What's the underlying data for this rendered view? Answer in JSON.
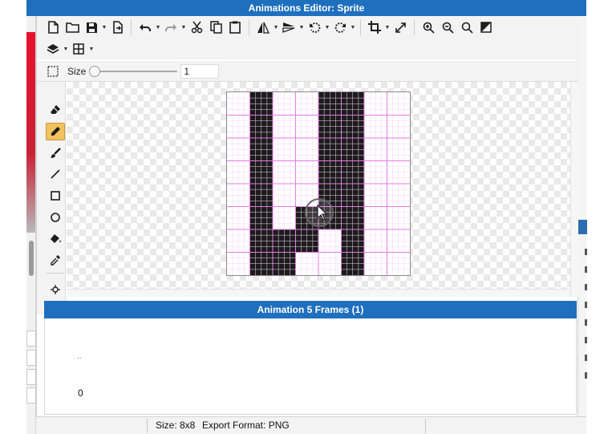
{
  "window": {
    "title": "Animations Editor: Sprite"
  },
  "toolbar_icons": {
    "row1": [
      "new-file-icon",
      "open-folder-icon",
      "save-icon",
      "save-caret",
      "export-icon",
      "undo-icon",
      "undo-caret",
      "redo-icon",
      "redo-caret",
      "cut-icon",
      "copy-icon",
      "paste-icon",
      "flip-horizontal-icon",
      "flip-horizontal-caret",
      "flip-vertical-icon",
      "flip-vertical-caret",
      "rotate-left-icon",
      "rotate-left-caret",
      "rotate-right-icon",
      "rotate-right-caret",
      "crop-icon",
      "crop-caret",
      "resize-icon",
      "zoom-in-icon",
      "zoom-out-icon",
      "zoom-reset-icon",
      "color-mode-icon"
    ],
    "row2": [
      "layers-icon",
      "layers-caret",
      "grid-icon",
      "grid-caret"
    ]
  },
  "brush": {
    "size_label": "Size",
    "size_value": "1",
    "slider_fraction": 0
  },
  "tools": [
    "eraser-icon",
    "pencil-icon",
    "brush-icon",
    "line-icon",
    "rectangle-icon",
    "ellipse-icon",
    "fill-icon",
    "eyedropper-icon",
    "move-icon"
  ],
  "active_tool": "pencil-icon",
  "sprite": {
    "width": 8,
    "height": 8,
    "pixels": [
      [
        0,
        1,
        0,
        0,
        1,
        1,
        0,
        0
      ],
      [
        0,
        1,
        0,
        0,
        1,
        1,
        0,
        0
      ],
      [
        0,
        1,
        0,
        0,
        1,
        1,
        0,
        0
      ],
      [
        0,
        1,
        0,
        0,
        1,
        1,
        0,
        0
      ],
      [
        0,
        1,
        0,
        0,
        1,
        1,
        0,
        0
      ],
      [
        0,
        1,
        0,
        1,
        1,
        1,
        0,
        0
      ],
      [
        0,
        1,
        1,
        1,
        0,
        1,
        0,
        0
      ],
      [
        0,
        1,
        1,
        0,
        0,
        1,
        0,
        0
      ]
    ],
    "fill_color": "#1b1b1b",
    "grid_color": "#e778e3"
  },
  "animation": {
    "header": "Animation 5 Frames (1)",
    "dots": "..",
    "frame_index": "0"
  },
  "status": {
    "size": "Size: 8x8",
    "export_format": "Export Format: PNG"
  },
  "colors": {
    "title_blue": "#1f6fbf",
    "active_tool": "#f3c15d"
  }
}
